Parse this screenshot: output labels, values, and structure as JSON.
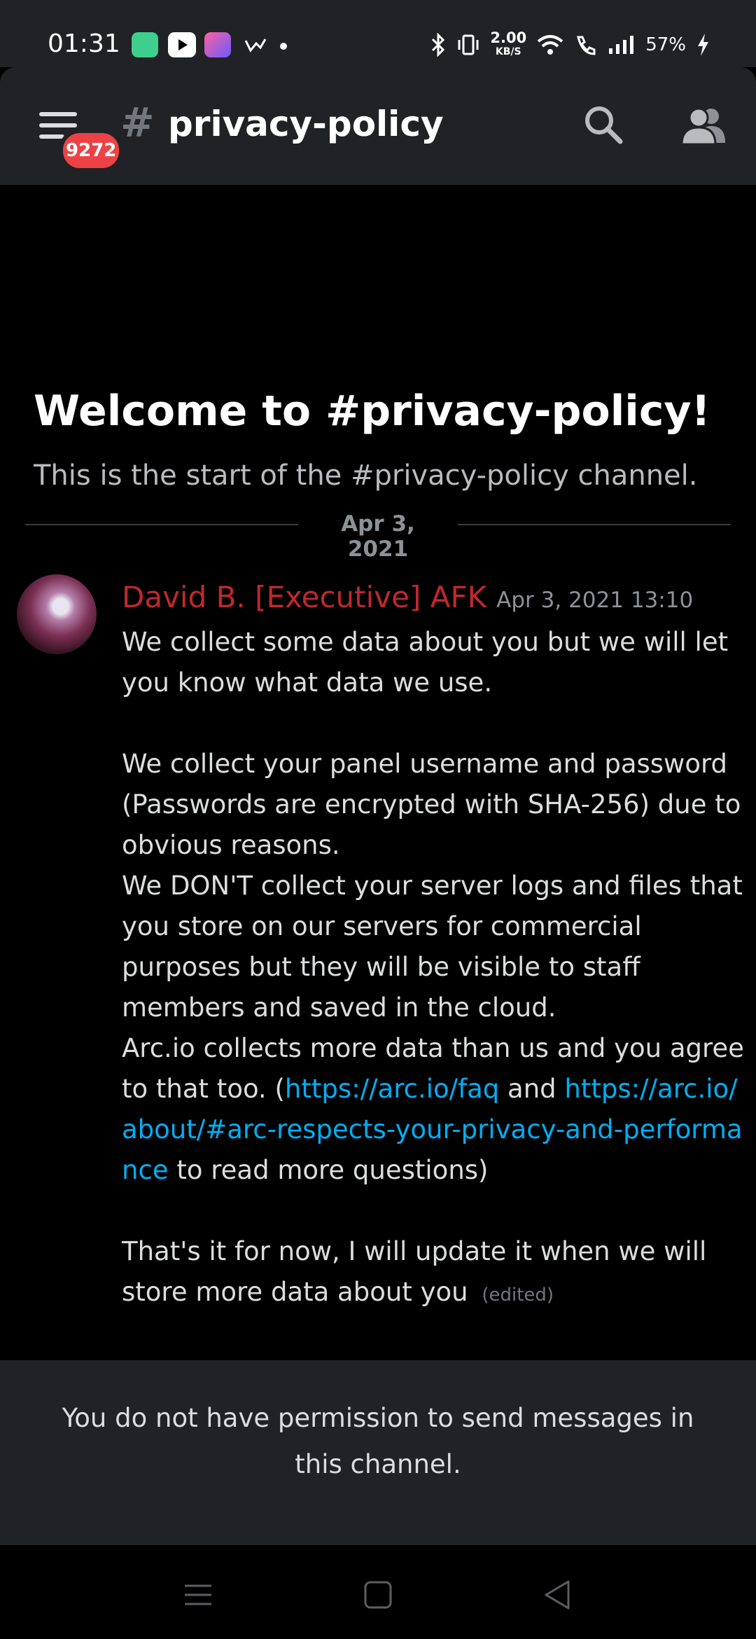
{
  "status_bar": {
    "time": "01:31",
    "network_speed_value": "2.00",
    "network_speed_unit": "KB/S",
    "battery": "57%"
  },
  "header": {
    "unread_count": "9272",
    "channel_name": "privacy-policy"
  },
  "welcome": {
    "title": "Welcome to #privacy-policy!",
    "subtitle": "This is the start of the #privacy-policy channel."
  },
  "divider_date": "Apr 3, 2021",
  "message": {
    "author": "David B. [Executive] AFK",
    "timestamp": "Apr 3, 2021 13:10",
    "p1": "We collect some data about you but we will let you know what data we use.",
    "p2": "We collect your panel username and password (Passwords are encrypted with SHA-256) due to obvious reasons.",
    "p3": "We DON'T collect your server logs and files that you store on our servers for commercial purposes but they will be visible to staff members and saved in the cloud.",
    "p4_pre": "Arc.io collects more data than us and you agree to that too. (",
    "link1": "https://arc.io/faq",
    "p4_mid": " and ",
    "link2": "https://arc.io/about/#arc-respects-your-privacy-and-performance",
    "p4_post": " to read more questions)",
    "p5": "That's it for now, I will update it when we will store more data about you",
    "edited": "(edited)"
  },
  "notice": "You do not have permission to send messages in this channel.",
  "colors": {
    "header_bg": "#202225",
    "author": "#c0282e",
    "link": "#00aff4",
    "badge": "#ed4245"
  }
}
